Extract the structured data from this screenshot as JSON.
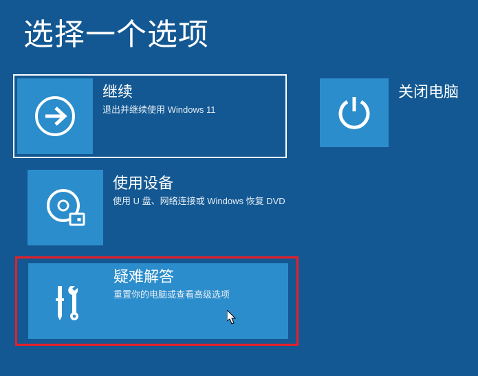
{
  "page": {
    "title": "选择一个选项"
  },
  "tiles": {
    "continue": {
      "title": "继续",
      "desc": "退出并继续使用 Windows 11"
    },
    "device": {
      "title": "使用设备",
      "desc": "使用 U 盘、网络连接或 Windows 恢复 DVD"
    },
    "troubleshoot": {
      "title": "疑难解答",
      "desc": "重置你的电脑或查看高级选项"
    },
    "power": {
      "title": "关闭电脑"
    }
  }
}
